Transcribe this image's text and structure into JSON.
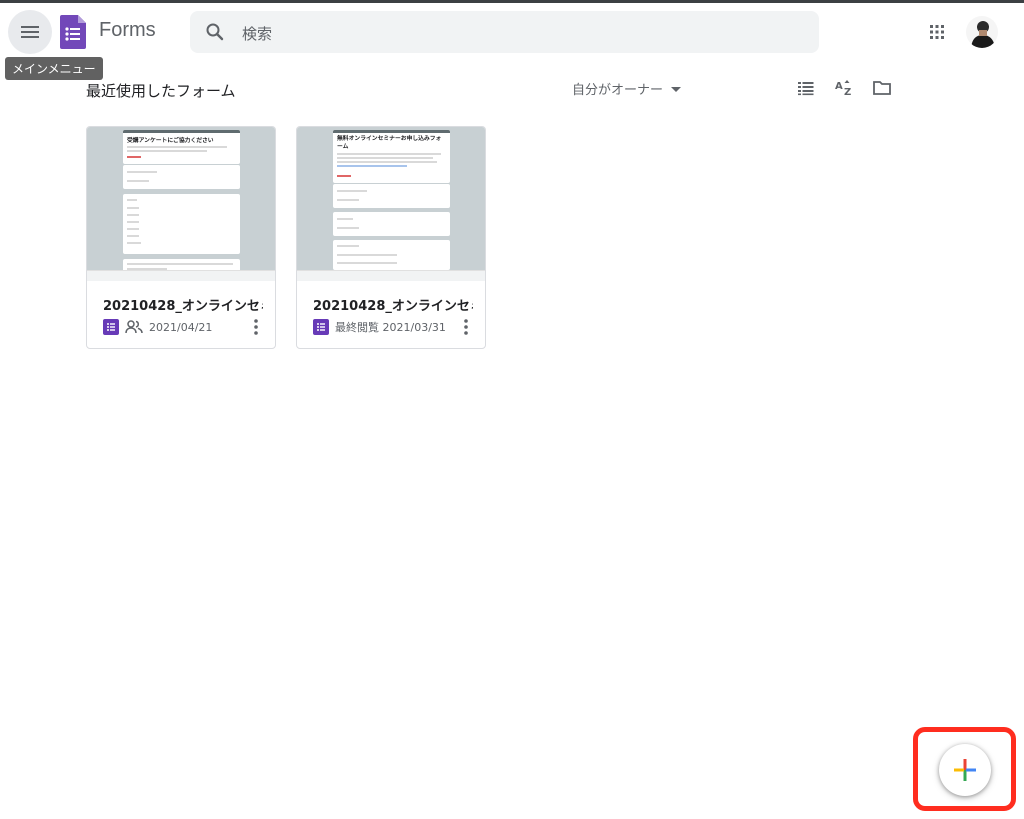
{
  "header": {
    "menu_tooltip": "メインメニュー",
    "app_name": "Forms",
    "search_placeholder": "検索"
  },
  "toolbar": {
    "section_title": "最近使用したフォーム",
    "owner_filter": "自分がオーナー"
  },
  "cards": [
    {
      "title": "20210428_オンラインセミ...",
      "date": "2021/04/21",
      "shared": true,
      "thumb_title": "受講アンケートにご協力ください"
    },
    {
      "title": "20210428_オンラインセミ...",
      "date": "最終閲覧 2021/03/31",
      "shared": false,
      "thumb_title": "無料オンラインセミナーお申し込みフォーム"
    }
  ],
  "colors": {
    "brand_purple": "#673ab7",
    "highlight_red": "#ff2d1f",
    "plus_blue": "#4285f4",
    "plus_red": "#ea4335",
    "plus_yellow": "#fbbc05",
    "plus_green": "#34a853"
  }
}
